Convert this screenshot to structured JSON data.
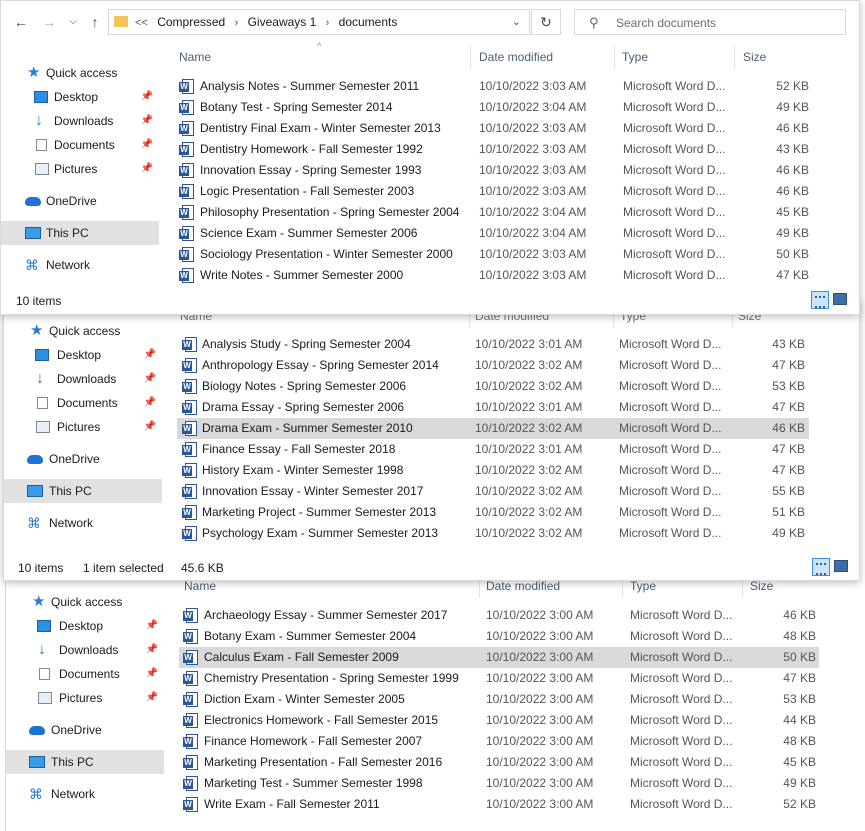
{
  "toolbar": {
    "breadcrumb_overflow": "<<",
    "crumbs": [
      "Compressed",
      "Giveaways 1",
      "documents"
    ],
    "search_placeholder": "Search documents"
  },
  "nav": {
    "quick_access": "Quick access",
    "desktop": "Desktop",
    "downloads": "Downloads",
    "documents": "Documents",
    "pictures": "Pictures",
    "onedrive": "OneDrive",
    "this_pc": "This PC",
    "network": "Network"
  },
  "columns": {
    "name": "Name",
    "date": "Date modified",
    "type": "Type",
    "size": "Size"
  },
  "window1": {
    "status_items": "10 items",
    "files": [
      {
        "name": "Analysis Notes - Summer Semester 2011",
        "date": "10/10/2022 3:03 AM",
        "type": "Microsoft Word D...",
        "size": "52 KB"
      },
      {
        "name": "Botany Test - Spring Semester 2014",
        "date": "10/10/2022 3:04 AM",
        "type": "Microsoft Word D...",
        "size": "49 KB"
      },
      {
        "name": "Dentistry Final Exam - Winter Semester 2013",
        "date": "10/10/2022 3:03 AM",
        "type": "Microsoft Word D...",
        "size": "46 KB"
      },
      {
        "name": "Dentistry Homework - Fall Semester 1992",
        "date": "10/10/2022 3:03 AM",
        "type": "Microsoft Word D...",
        "size": "43 KB"
      },
      {
        "name": "Innovation Essay - Spring Semester 1993",
        "date": "10/10/2022 3:03 AM",
        "type": "Microsoft Word D...",
        "size": "46 KB"
      },
      {
        "name": "Logic Presentation - Fall Semester 2003",
        "date": "10/10/2022 3:03 AM",
        "type": "Microsoft Word D...",
        "size": "46 KB"
      },
      {
        "name": "Philosophy Presentation - Spring Semester 2004",
        "date": "10/10/2022 3:04 AM",
        "type": "Microsoft Word D...",
        "size": "45 KB"
      },
      {
        "name": "Science Exam - Summer Semester 2006",
        "date": "10/10/2022 3:04 AM",
        "type": "Microsoft Word D...",
        "size": "49 KB"
      },
      {
        "name": "Sociology Presentation - Winter Semester 2000",
        "date": "10/10/2022 3:03 AM",
        "type": "Microsoft Word D...",
        "size": "50 KB"
      },
      {
        "name": "Write Notes - Summer Semester 2000",
        "date": "10/10/2022 3:03 AM",
        "type": "Microsoft Word D...",
        "size": "47 KB"
      }
    ]
  },
  "window2": {
    "status_items": "10 items",
    "status_selected": "1 item selected",
    "status_size": "45.6 KB",
    "files": [
      {
        "name": "Analysis Study - Spring Semester 2004",
        "date": "10/10/2022 3:01 AM",
        "type": "Microsoft Word D...",
        "size": "43 KB"
      },
      {
        "name": "Anthropology Essay - Spring Semester 2014",
        "date": "10/10/2022 3:02 AM",
        "type": "Microsoft Word D...",
        "size": "47 KB"
      },
      {
        "name": "Biology Notes - Spring Semester 2006",
        "date": "10/10/2022 3:02 AM",
        "type": "Microsoft Word D...",
        "size": "53 KB"
      },
      {
        "name": "Drama Essay - Spring Semester 2006",
        "date": "10/10/2022 3:01 AM",
        "type": "Microsoft Word D...",
        "size": "47 KB"
      },
      {
        "name": "Drama Exam - Summer Semester 2010",
        "date": "10/10/2022 3:02 AM",
        "type": "Microsoft Word D...",
        "size": "46 KB"
      },
      {
        "name": "Finance Essay - Fall Semester 2018",
        "date": "10/10/2022 3:01 AM",
        "type": "Microsoft Word D...",
        "size": "47 KB"
      },
      {
        "name": "History Exam - Winter Semester 1998",
        "date": "10/10/2022 3:02 AM",
        "type": "Microsoft Word D...",
        "size": "47 KB"
      },
      {
        "name": "Innovation Essay - Winter Semester 2017",
        "date": "10/10/2022 3:02 AM",
        "type": "Microsoft Word D...",
        "size": "55 KB"
      },
      {
        "name": "Marketing Project - Summer Semester 2013",
        "date": "10/10/2022 3:02 AM",
        "type": "Microsoft Word D...",
        "size": "51 KB"
      },
      {
        "name": "Psychology Exam - Summer Semester 2013",
        "date": "10/10/2022 3:02 AM",
        "type": "Microsoft Word D...",
        "size": "49 KB"
      }
    ]
  },
  "window3": {
    "files": [
      {
        "name": "Archaeology Essay - Summer Semester 2017",
        "date": "10/10/2022 3:00 AM",
        "type": "Microsoft Word D...",
        "size": "46 KB"
      },
      {
        "name": "Botany Exam - Summer Semester 2004",
        "date": "10/10/2022 3:00 AM",
        "type": "Microsoft Word D...",
        "size": "48 KB"
      },
      {
        "name": "Calculus Exam - Fall Semester 2009",
        "date": "10/10/2022 3:00 AM",
        "type": "Microsoft Word D...",
        "size": "50 KB"
      },
      {
        "name": "Chemistry Presentation - Spring Semester 1999",
        "date": "10/10/2022 3:00 AM",
        "type": "Microsoft Word D...",
        "size": "47 KB"
      },
      {
        "name": "Diction Exam - Winter Semester 2005",
        "date": "10/10/2022 3:00 AM",
        "type": "Microsoft Word D...",
        "size": "53 KB"
      },
      {
        "name": "Electronics Homework - Fall Semester 2015",
        "date": "10/10/2022 3:00 AM",
        "type": "Microsoft Word D...",
        "size": "44 KB"
      },
      {
        "name": "Finance Homework - Fall Semester 2007",
        "date": "10/10/2022 3:00 AM",
        "type": "Microsoft Word D...",
        "size": "48 KB"
      },
      {
        "name": "Marketing Presentation - Fall Semester 2016",
        "date": "10/10/2022 3:00 AM",
        "type": "Microsoft Word D...",
        "size": "45 KB"
      },
      {
        "name": "Marketing Test - Summer Semester 1998",
        "date": "10/10/2022 3:00 AM",
        "type": "Microsoft Word D...",
        "size": "49 KB"
      },
      {
        "name": "Write Exam - Fall Semester 2011",
        "date": "10/10/2022 3:00 AM",
        "type": "Microsoft Word D...",
        "size": "52 KB"
      }
    ]
  }
}
